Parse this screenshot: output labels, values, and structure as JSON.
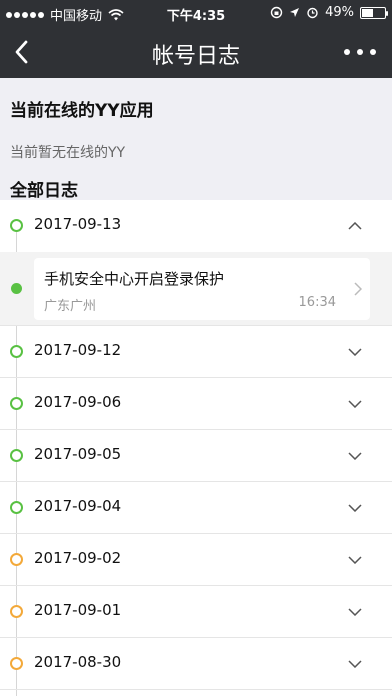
{
  "status_bar": {
    "carrier": "中国移动",
    "time": "下午4:35",
    "battery": "49%",
    "battery_level": 0.49
  },
  "nav": {
    "title": "帐号日志"
  },
  "online_section": {
    "title": "当前在线的YY应用",
    "empty_text": "当前暂无在线的YY"
  },
  "logs_section": {
    "title": "全部日志"
  },
  "dates": [
    {
      "date": "2017-09-13",
      "status": "green",
      "expanded": true
    },
    {
      "date": "2017-09-12",
      "status": "green",
      "expanded": false
    },
    {
      "date": "2017-09-06",
      "status": "green",
      "expanded": false
    },
    {
      "date": "2017-09-05",
      "status": "green",
      "expanded": false
    },
    {
      "date": "2017-09-04",
      "status": "green",
      "expanded": false
    },
    {
      "date": "2017-09-02",
      "status": "orange",
      "expanded": false
    },
    {
      "date": "2017-09-01",
      "status": "orange",
      "expanded": false
    },
    {
      "date": "2017-08-30",
      "status": "orange",
      "expanded": false
    }
  ],
  "expanded_log": {
    "title": "手机安全中心开启登录保护",
    "location": "广东广州",
    "time": "16:34"
  },
  "colors": {
    "header_bg": "#2f3135",
    "green": "#59c143",
    "orange": "#f3a93a"
  },
  "icons": {
    "back": "chevron-left-icon",
    "more": "more-dots-icon",
    "expand": "chevron-down-icon",
    "collapse": "chevron-up-icon",
    "detail": "chevron-right-icon"
  }
}
